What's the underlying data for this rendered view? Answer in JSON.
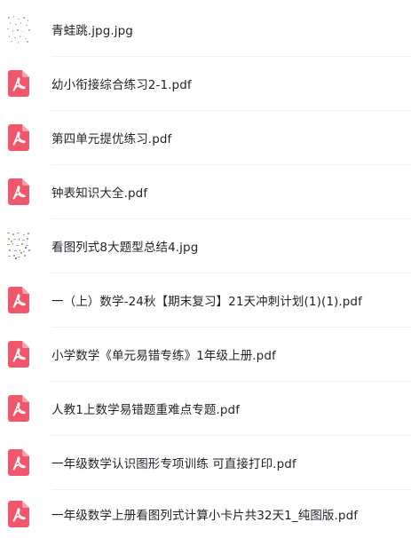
{
  "colors": {
    "pdf_icon": "#f1566a",
    "text": "#1f2329",
    "divider": "#f1f1f3"
  },
  "files": [
    {
      "name": "青蛙跳.jpg.jpg",
      "icon": "image-thumbnail-icon"
    },
    {
      "name": "幼小衔接综合练习2-1.pdf",
      "icon": "pdf-icon"
    },
    {
      "name": "第四单元提优练习.pdf",
      "icon": "pdf-icon"
    },
    {
      "name": "钟表知识大全.pdf",
      "icon": "pdf-icon"
    },
    {
      "name": "看图列式8大题型总结4.jpg",
      "icon": "image-thumbnail-icon"
    },
    {
      "name": "一（上）数学-24秋【期末复习】21天冲刺计划(1)(1).pdf",
      "icon": "pdf-icon"
    },
    {
      "name": "小学数学《单元易错专练》1年级上册.pdf",
      "icon": "pdf-icon"
    },
    {
      "name": "人教1上数学易错题重难点专题.pdf",
      "icon": "pdf-icon"
    },
    {
      "name": "一年级数学认识图形专项训练 可直接打印.pdf",
      "icon": "pdf-icon"
    },
    {
      "name": "一年级数学上册看图列式计算小卡片共32天1_纯图版.pdf",
      "icon": "pdf-icon"
    }
  ]
}
